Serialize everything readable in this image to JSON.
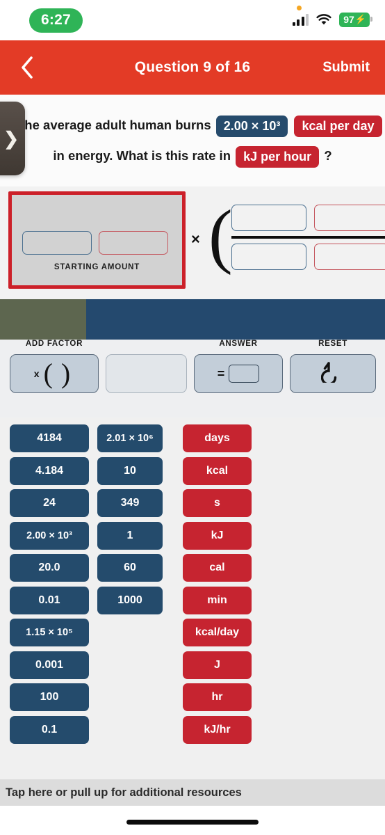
{
  "status_bar": {
    "time": "6:27",
    "battery_level": "97",
    "battery_charging_icon": "lightning-bolt-icon",
    "signal_icon": "cellular-signal-icon",
    "wifi_icon": "wifi-icon",
    "recording_dot_icon": "orange-status-dot-icon"
  },
  "header": {
    "back_icon": "chevron-left-icon",
    "title": "Question 9 of 16",
    "submit_label": "Submit",
    "background_color": "#e33b26"
  },
  "drawer": {
    "handle_icon": "chevron-right-icon"
  },
  "question": {
    "line1_prefix": "The average adult human burns",
    "value_pill": "2.00 × 10³",
    "unit_pill": "kcal per day",
    "line2_prefix": "in energy. What is this rate in",
    "target_unit_pill": "kJ per hour",
    "line2_suffix": "?"
  },
  "work_area": {
    "starting_amount_label": "STARTING AMOUNT",
    "starting_slot_value": "",
    "starting_unit_slot_value": "",
    "multiply_symbol": "×",
    "open_paren": "(",
    "numerator_value_slot": "",
    "numerator_unit_slot": "",
    "denominator_value_slot": "",
    "denominator_unit_slot": "",
    "highlight_border_color": "#cc2029"
  },
  "progress": {
    "fill_color": "#5d664f",
    "track_color": "#24496e"
  },
  "toolbar": {
    "add_factor_label": "ADD FACTOR",
    "add_factor_x": "x",
    "add_factor_open_paren": "(",
    "add_factor_close_paren": ")",
    "answer_label": "ANSWER",
    "answer_equals": "=",
    "reset_label": "RESET",
    "reset_icon": "undo-arrow-icon"
  },
  "tiles": {
    "numbers_col1": [
      "4184",
      "4.184",
      "24",
      "2.00 × 10³",
      "20.0",
      "0.01",
      "1.15 × 10⁵",
      "0.001",
      "100",
      "0.1"
    ],
    "numbers_col2": [
      "2.01 × 10⁶",
      "10",
      "349",
      "1",
      "60",
      "1000"
    ],
    "units_col3": [
      "days",
      "kcal",
      "s",
      "kJ",
      "cal",
      "min",
      "kcal/day",
      "J",
      "hr",
      "kJ/hr"
    ],
    "number_color": "#244b6c",
    "unit_color": "#c62430"
  },
  "bottom": {
    "resources_text": "Tap here or pull up for additional resources"
  }
}
